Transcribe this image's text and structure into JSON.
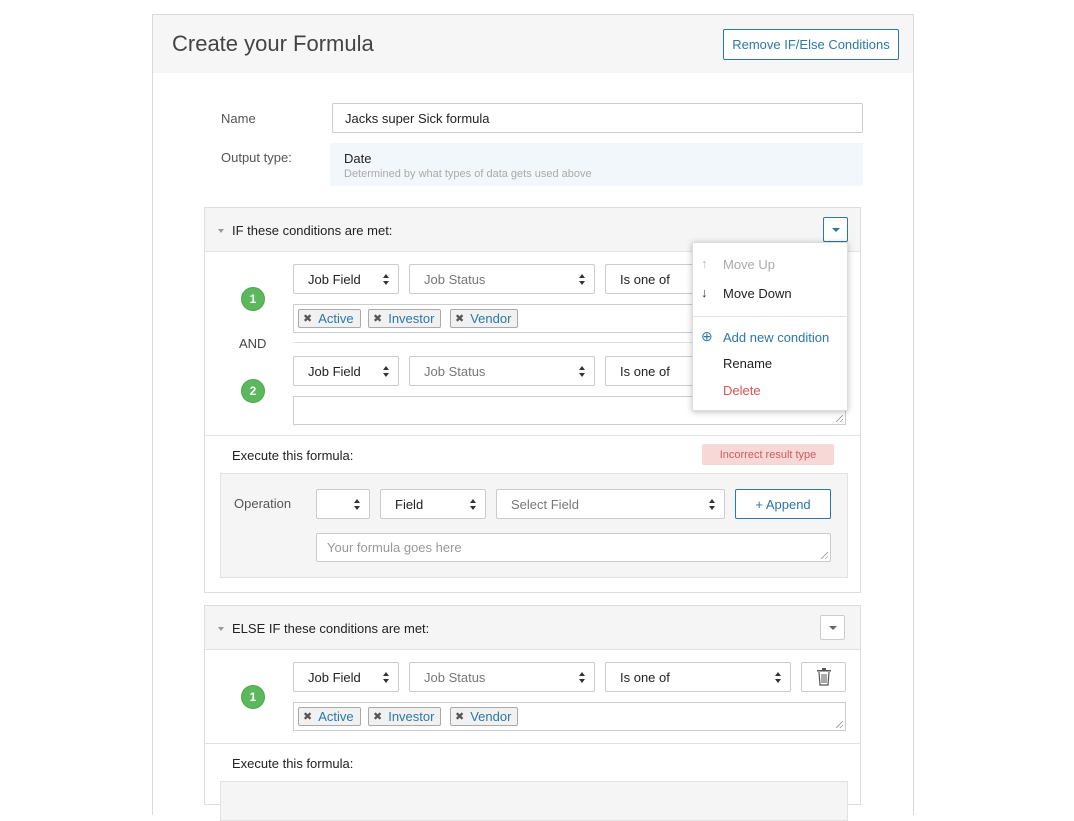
{
  "header": {
    "title": "Create your Formula",
    "remove_button": "Remove IF/Else Conditions"
  },
  "form": {
    "name_label": "Name",
    "name_value": "Jacks super Sick formula",
    "output_label": "Output type:",
    "output_value": "Date",
    "output_hint": "Determined by what types of data gets used above"
  },
  "if_section": {
    "title": "IF these conditions are met:",
    "and_label": "AND",
    "conditions": [
      {
        "number": "1",
        "field_type": "Job Field",
        "field": "Job Status",
        "operator": "Is one of",
        "tags": [
          "Active",
          "Investor",
          "Vendor"
        ]
      },
      {
        "number": "2",
        "field_type": "Job Field",
        "field": "Job Status",
        "operator": "Is one of",
        "tags": []
      }
    ],
    "execute_label": "Execute this formula:",
    "error_badge": "Incorrect result type",
    "operation_label": "Operation",
    "op_select": "",
    "field_select": "Field",
    "select_field_placeholder": "Select Field",
    "append_button": "+ Append",
    "formula_placeholder": "Your formula goes here"
  },
  "dropdown_menu": {
    "move_up": "Move Up",
    "move_down": "Move Down",
    "add_condition": "Add new condition",
    "rename": "Rename",
    "delete": "Delete"
  },
  "else_section": {
    "title": "ELSE IF these conditions are met:",
    "conditions": [
      {
        "number": "1",
        "field_type": "Job Field",
        "field": "Job Status",
        "operator": "Is one of",
        "tags": [
          "Active",
          "Investor",
          "Vendor"
        ]
      }
    ],
    "execute_label": "Execute this formula:"
  },
  "colors": {
    "accent": "#2b78a8",
    "success": "#5cb85c",
    "danger": "#d9534f",
    "error_bg": "#f8d7d7"
  }
}
